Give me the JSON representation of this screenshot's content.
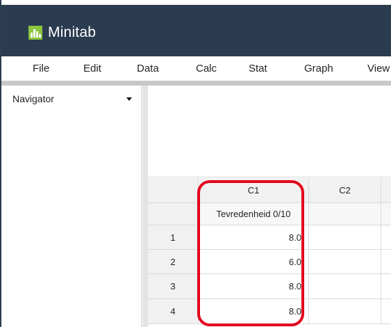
{
  "app": {
    "title": "Minitab",
    "logo_icon": "minitab-logo-icon"
  },
  "menu": [
    "File",
    "Edit",
    "Data",
    "Calc",
    "Stat",
    "Graph",
    "View"
  ],
  "navigator": {
    "title": "Navigator",
    "dropdown_icon": "chevron-down-icon"
  },
  "worksheet": {
    "columns": [
      {
        "id": "C1",
        "name": "Tevredenheid 0/10"
      },
      {
        "id": "C2",
        "name": ""
      }
    ],
    "rows": [
      {
        "num": "1",
        "values": [
          "8.0",
          ""
        ]
      },
      {
        "num": "2",
        "values": [
          "6.0",
          ""
        ]
      },
      {
        "num": "3",
        "values": [
          "8.0",
          ""
        ]
      },
      {
        "num": "4",
        "values": [
          "8.0",
          ""
        ]
      }
    ]
  },
  "colors": {
    "titlebar": "#2b3b50",
    "logo": "#8dc63f",
    "highlight": "#e3001b"
  }
}
